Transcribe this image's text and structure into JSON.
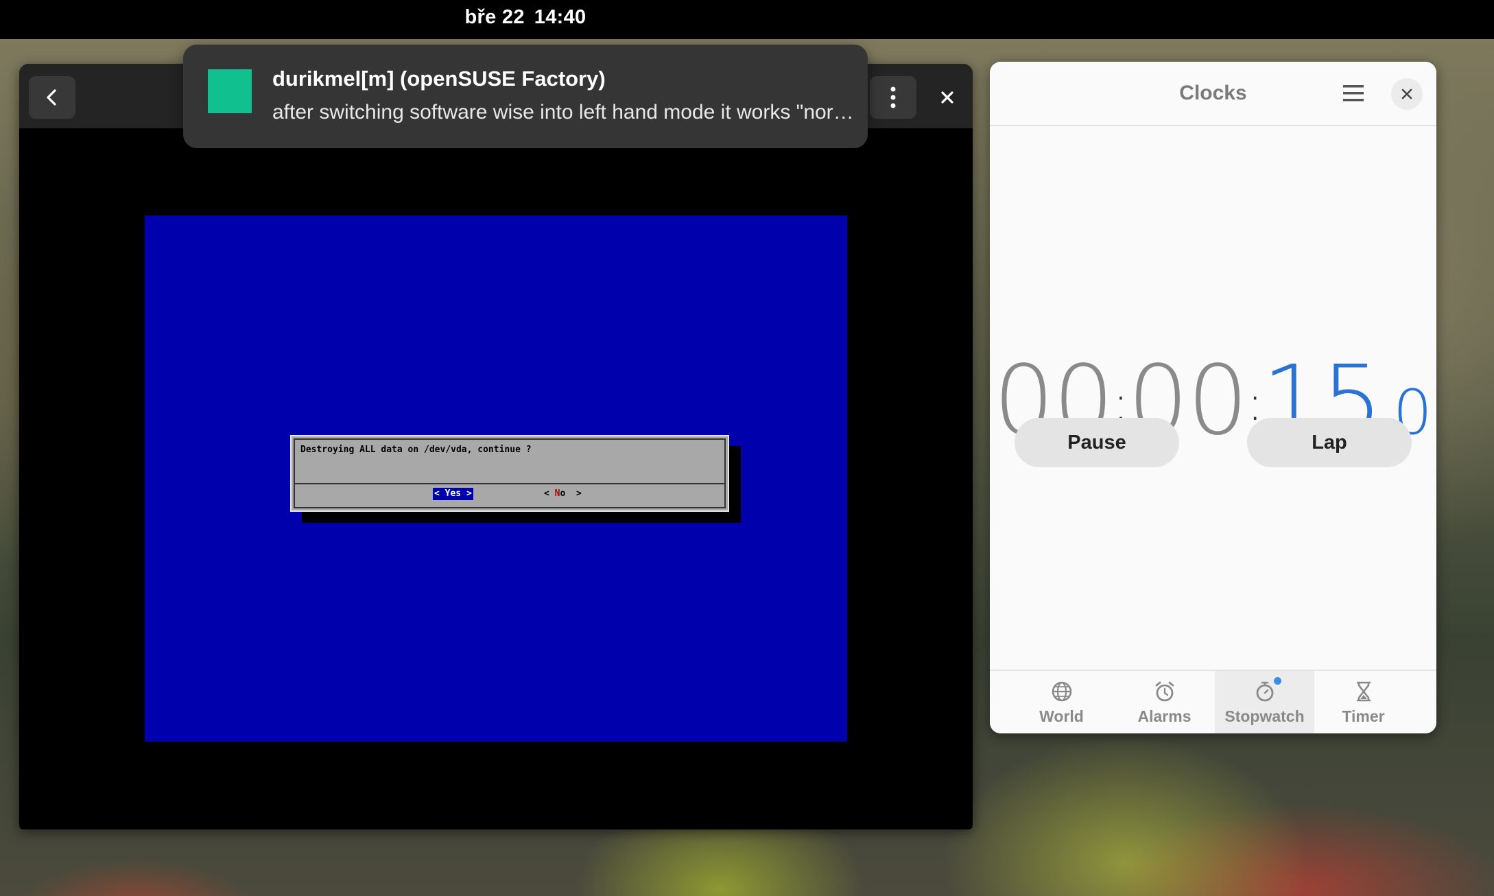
{
  "topbar": {
    "date": "bře 22",
    "time": "14:40"
  },
  "notification": {
    "title": "durikmel[m] (openSUSE Factory)",
    "body": "after switching software wise into left hand mode it works \"normally\""
  },
  "vm": {
    "dialog": {
      "message": "Destroying ALL data on /dev/vda, continue ?",
      "yes_label": "< Yes >",
      "no_open": "< ",
      "no_hot": "N",
      "no_rest": "o",
      "no_close": "  >"
    }
  },
  "clocks": {
    "title": "Clocks",
    "stopwatch": {
      "hours": "00",
      "minutes": "00",
      "seconds": "15",
      "tenths": "0"
    },
    "pause_label": "Pause",
    "lap_label": "Lap",
    "tabs": {
      "world": "World",
      "alarms": "Alarms",
      "stopwatch": "Stopwatch",
      "timer": "Timer"
    },
    "active_tab": "Stopwatch",
    "accent_color": "#2a72d4"
  },
  "icons": [
    "back-icon",
    "kebab-menu-icon",
    "close-icon",
    "hamburger-menu-icon",
    "globe-icon",
    "alarm-clock-icon",
    "stopwatch-icon",
    "hourglass-icon"
  ]
}
